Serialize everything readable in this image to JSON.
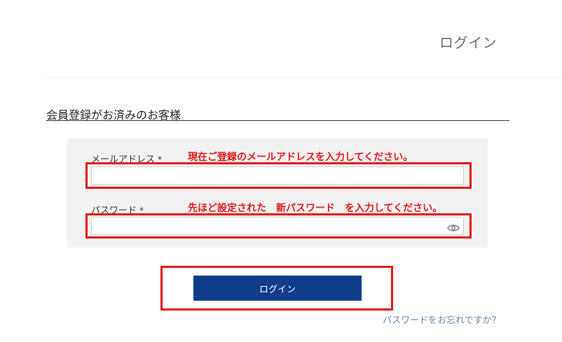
{
  "header": {
    "title": "ログイン"
  },
  "section": {
    "title": "会員登録がお済みのお客様"
  },
  "form": {
    "email": {
      "label": "メールアドレス",
      "required_mark": "*",
      "value": ""
    },
    "password": {
      "label": "パスワード",
      "required_mark": "*",
      "value": ""
    },
    "submit_label": "ログイン"
  },
  "annotations": {
    "email_hint": "現在ご登録のメールアドレスを入力してください。",
    "password_hint": "先ほど設定された　新パスワード　を入力してください。",
    "color": "#e01818"
  },
  "links": {
    "forgot_password": "パスワードをお忘れですか？"
  },
  "icons": {
    "password_toggle": "eye-icon"
  },
  "colors": {
    "button_bg": "#0e3d8a",
    "link": "#6a89a8",
    "panel_bg": "#f2f2f2"
  }
}
